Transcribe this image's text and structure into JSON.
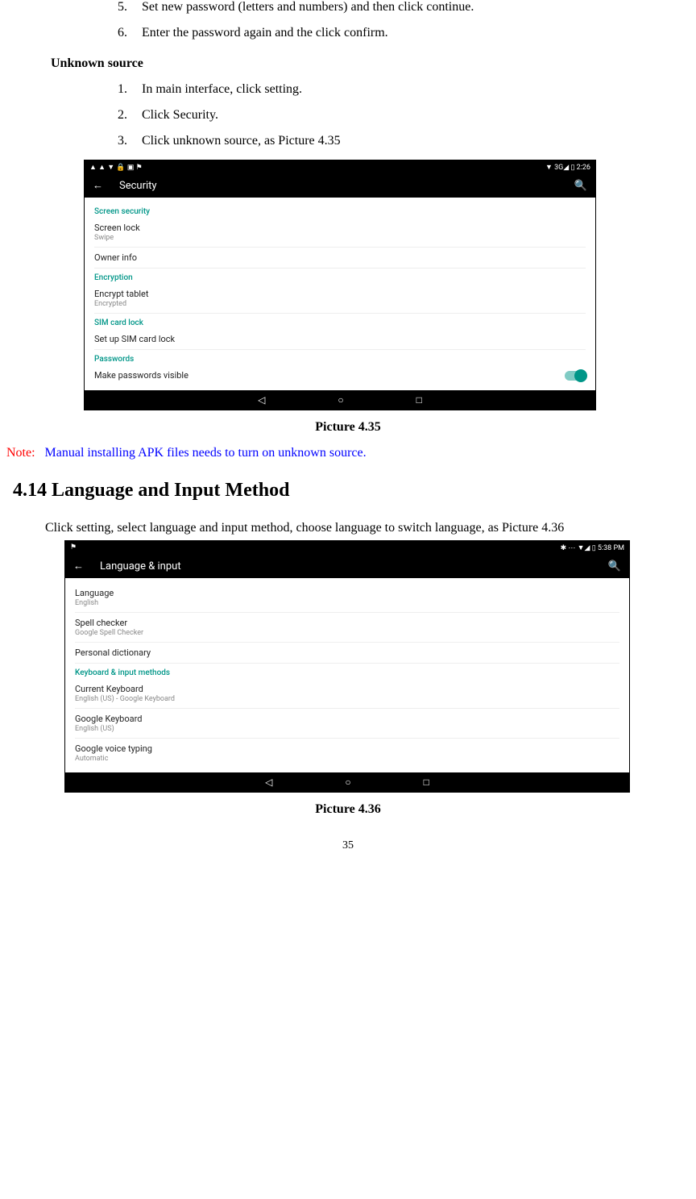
{
  "list1": {
    "items": [
      {
        "num": "5.",
        "text": "Set new password (letters and numbers) and then click continue."
      },
      {
        "num": "6.",
        "text": "Enter the password again and the click confirm."
      }
    ]
  },
  "subheading1": "Unknown source",
  "list2": {
    "items": [
      {
        "num": "1.",
        "text": "In main interface, click setting."
      },
      {
        "num": "2.",
        "text": "Click Security."
      },
      {
        "num": "3.",
        "text": "Click unknown source, as Picture 4.35"
      }
    ]
  },
  "screenshot1": {
    "status_left": "▲ ▲ ▼ 🔒 ▣ ⚑",
    "status_right": "▼ 3G◢ ▯ 2:26",
    "back": "←",
    "title": "Security",
    "search": "🔍",
    "sect1": "Screen security",
    "row1a": "Screen lock",
    "row1b": "Swipe",
    "row2a": "Owner info",
    "sect2": "Encryption",
    "row3a": "Encrypt tablet",
    "row3b": "Encrypted",
    "sect3": "SIM card lock",
    "row4a": "Set up SIM card lock",
    "sect4": "Passwords",
    "row5a": "Make passwords visible",
    "nav_back": "◁",
    "nav_home": "○",
    "nav_recent": "□"
  },
  "caption1": "Picture 4.35",
  "note": {
    "label": "Note:",
    "text": "Manual installing APK files needs to turn on unknown source."
  },
  "section_heading": "4.14  Language and Input Method",
  "paragraph": "Click setting, select language and input method, choose language to switch language, as Picture 4.36",
  "screenshot2": {
    "status_left": "⚑",
    "status_right": "✱ ⋯ ▼◢ ▯ 5:38 PM",
    "back": "←",
    "title": "Language & input",
    "search": "🔍",
    "row1a": "Language",
    "row1b": "English",
    "row2a": "Spell checker",
    "row2b": "Google Spell Checker",
    "row3a": "Personal dictionary",
    "sect1": "Keyboard & input methods",
    "row4a": "Current Keyboard",
    "row4b": "English (US) - Google Keyboard",
    "row5a": "Google Keyboard",
    "row5b": "English (US)",
    "row6a": "Google voice typing",
    "row6b": "Automatic",
    "nav_back": "◁",
    "nav_home": "○",
    "nav_recent": "□"
  },
  "caption2": "Picture 4.36",
  "page_number": "35"
}
